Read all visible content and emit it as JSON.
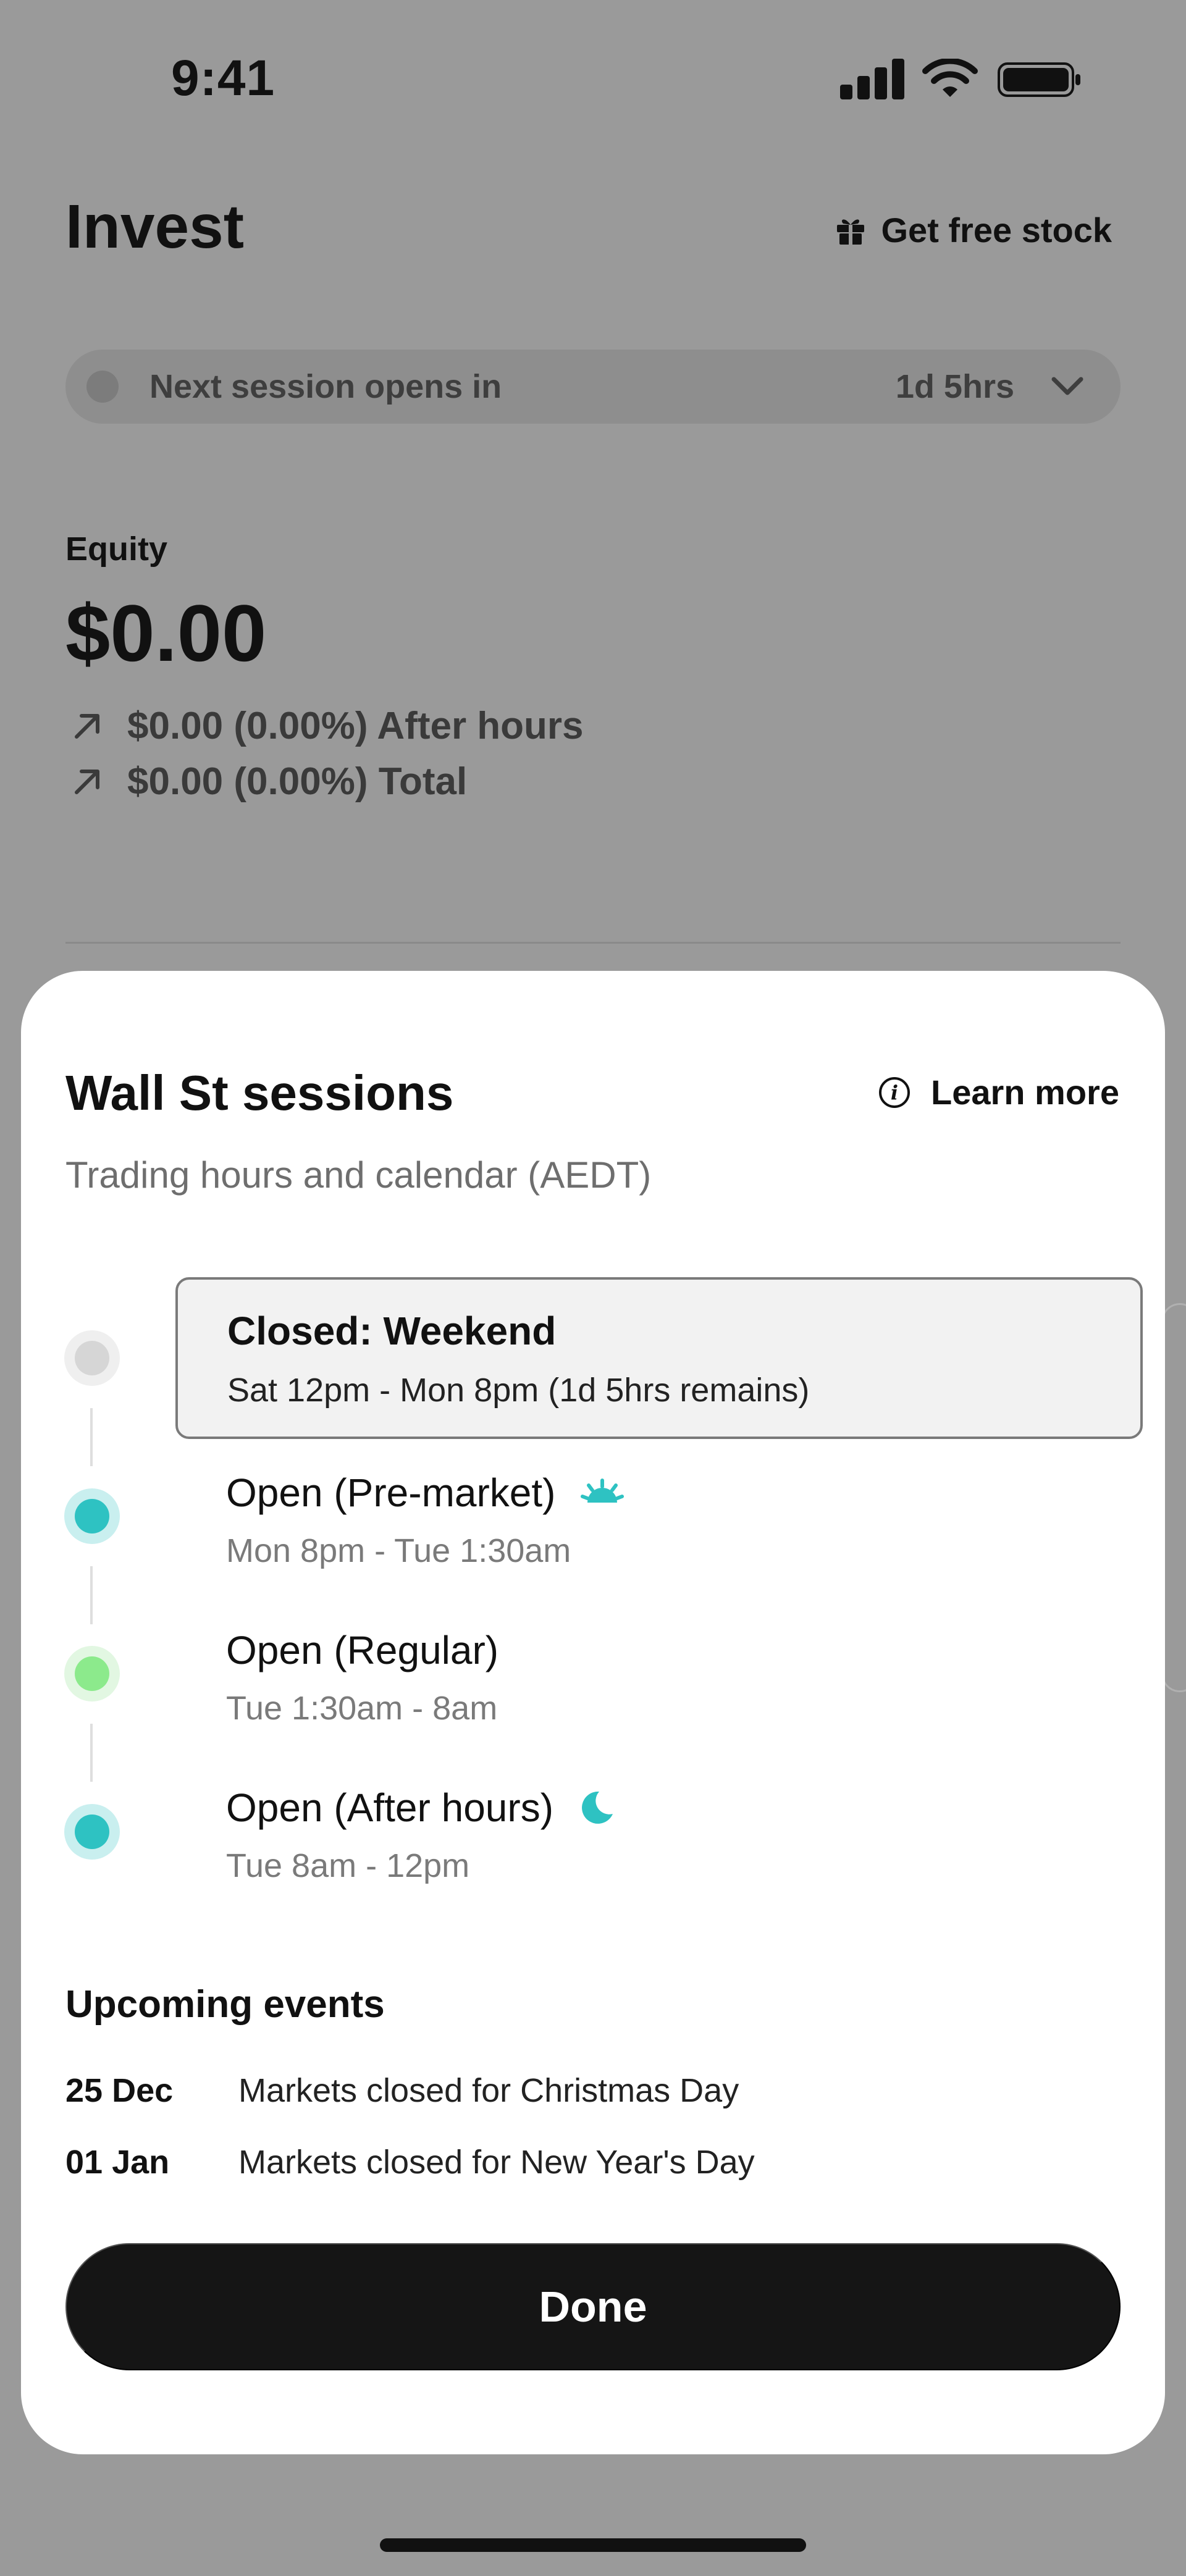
{
  "status_bar": {
    "time": "9:41"
  },
  "header": {
    "title": "Invest",
    "free_stock_label": "Get free stock"
  },
  "session_pill": {
    "label": "Next session opens in",
    "time": "1d 5hrs"
  },
  "equity": {
    "label": "Equity",
    "value": "$0.00",
    "after_hours": "$0.00 (0.00%) After hours",
    "total": "$0.00 (0.00%) Total"
  },
  "sheet": {
    "title": "Wall St sessions",
    "learn_more": "Learn more",
    "subtitle": "Trading hours and calendar (AEDT)",
    "sessions": [
      {
        "title": "Closed: Weekend",
        "time": "Sat 12pm - Mon 8pm (1d 5hrs remains)",
        "dot_color": "#d6d6d6",
        "halo": "#efefef"
      },
      {
        "title": "Open (Pre-market)",
        "time": "Mon 8pm - Tue 1:30am",
        "dot_color": "#2ec2c2",
        "halo": "#c9efef"
      },
      {
        "title": "Open (Regular)",
        "time": "Tue 1:30am - 8am",
        "dot_color": "#8cea8c",
        "halo": "#e2f7e2"
      },
      {
        "title": "Open (After hours)",
        "time": "Tue 8am - 12pm",
        "dot_color": "#2ec2c2",
        "halo": "#c9efef"
      }
    ],
    "events_title": "Upcoming events",
    "events": [
      {
        "date": "25 Dec",
        "text": "Markets closed for Christmas Day"
      },
      {
        "date": "01 Jan",
        "text": "Markets closed for New Year's Day"
      }
    ],
    "done_label": "Done"
  },
  "colors": {
    "accent_teal": "#2ec2c2",
    "accent_green": "#8cea8c",
    "button_dark": "#151515"
  }
}
